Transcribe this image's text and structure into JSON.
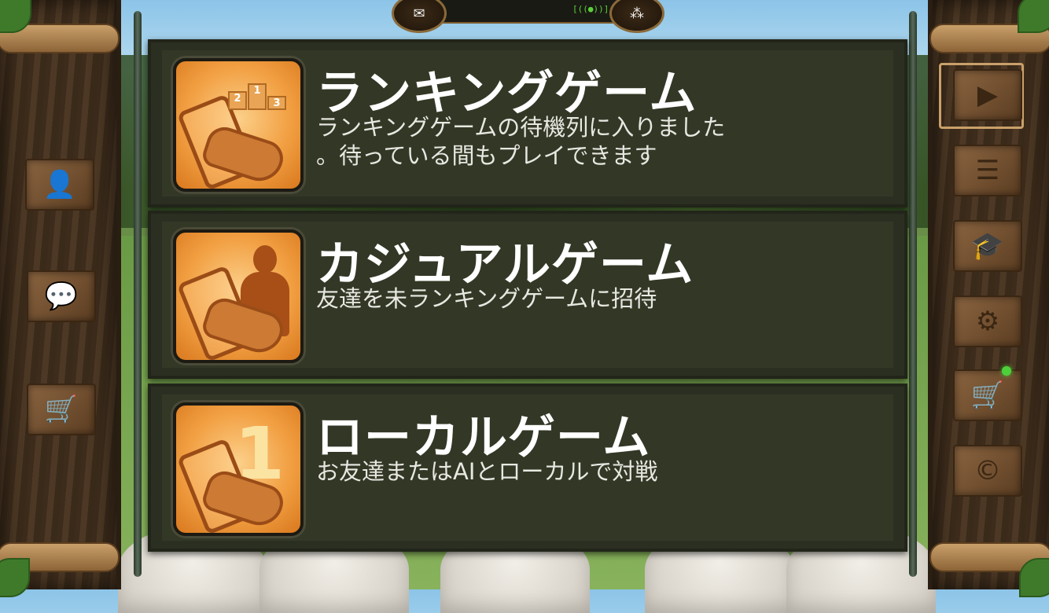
{
  "topbar": {
    "mail_icon": "envelope-icon",
    "signal_text": "[((●))]",
    "network_icon": "network-icon"
  },
  "left_menu": [
    {
      "name": "profile",
      "icon": "person-icon",
      "glyph": "👤"
    },
    {
      "name": "chat",
      "icon": "speech-bubble-icon",
      "glyph": "💬"
    },
    {
      "name": "shop",
      "icon": "cart-icon",
      "glyph": "🛒"
    }
  ],
  "right_menu": [
    {
      "name": "play",
      "icon": "play-icon",
      "glyph": "▶"
    },
    {
      "name": "list",
      "icon": "list-icon",
      "glyph": "☰"
    },
    {
      "name": "tutorial",
      "icon": "graduation-cap-icon",
      "glyph": "🎓"
    },
    {
      "name": "settings",
      "icon": "gear-icon",
      "glyph": "⚙"
    },
    {
      "name": "store",
      "icon": "cart-icon",
      "glyph": "🛒"
    },
    {
      "name": "credits",
      "icon": "copyright-icon",
      "glyph": "©"
    }
  ],
  "modes": [
    {
      "title": "ランキングゲーム",
      "description_line1": "ランキングゲームの待機列に入りました",
      "description_line2": "。待っている間もプレイできます",
      "icon": "ranking-podium-icon",
      "podium": [
        "2",
        "1",
        "3"
      ]
    },
    {
      "title": "カジュアルゲーム",
      "description_line1": "友達を未ランキングゲームに招待",
      "icon": "casual-friend-icon"
    },
    {
      "title": "ローカルゲーム",
      "description_line1": "お友達またはAIとローカルで対戦",
      "icon": "local-game-icon",
      "digit": "1"
    }
  ]
}
